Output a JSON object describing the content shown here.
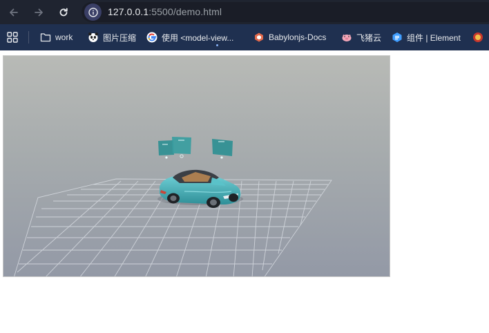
{
  "browser": {
    "url_host": "127.0.0.1",
    "url_rest": ":5500/demo.html",
    "icons": {
      "back": "arrow-left-icon",
      "forward": "arrow-right-icon",
      "reload": "reload-icon",
      "site_info": "info-icon",
      "apps": "apps-grid-icon"
    }
  },
  "bookmarks": [
    {
      "label": "work",
      "icon": "folder-icon"
    },
    {
      "label": "图片压缩",
      "icon": "panda-icon"
    },
    {
      "label": "使用 <model-view...",
      "icon": "google-icon"
    },
    {
      "label": "Babylonjs-Docs",
      "icon": "babylon-icon"
    },
    {
      "label": "飞猪云",
      "icon": "pig-icon"
    },
    {
      "label": "组件 | Element",
      "icon": "element-icon"
    }
  ],
  "scene": {
    "model": "car",
    "colors": {
      "car_body": "#3fb0b8",
      "hotspot_panel": "#2f8f92",
      "grid": "#d8dce2"
    }
  }
}
